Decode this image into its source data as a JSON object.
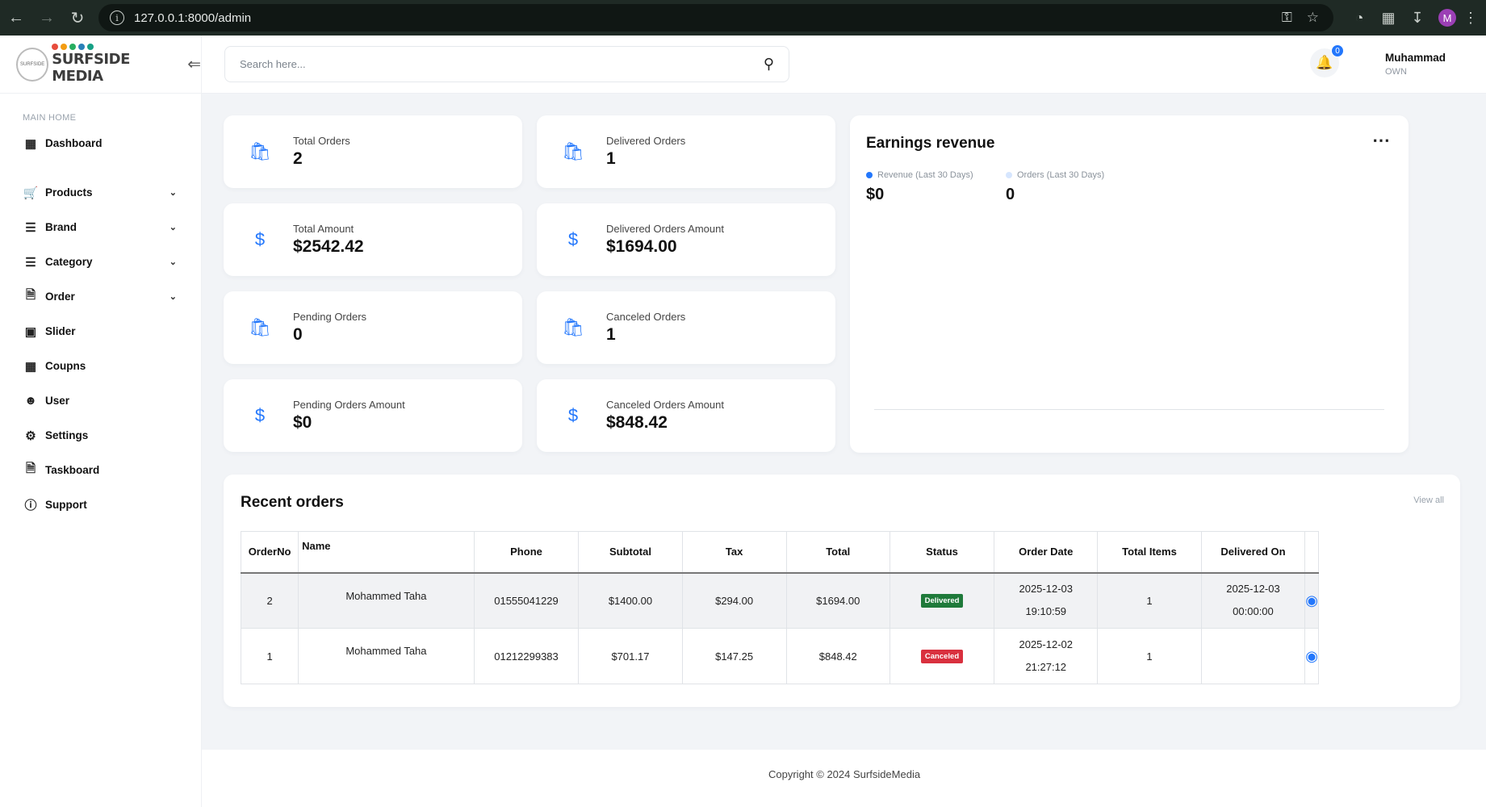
{
  "browser": {
    "url": "127.0.0.1:8000/admin",
    "profile_initial": "M"
  },
  "sidebar": {
    "logo_text": "SURFSIDE MEDIA",
    "section_label": "MAIN HOME",
    "items": [
      {
        "label": "Dashboard",
        "icon": "grid-icon"
      },
      {
        "label": "Products",
        "icon": "cart-icon"
      },
      {
        "label": "Brand",
        "icon": "layers-icon"
      },
      {
        "label": "Category",
        "icon": "layers-icon"
      },
      {
        "label": "Order",
        "icon": "file-plus-icon"
      },
      {
        "label": "Slider",
        "icon": "image-icon"
      },
      {
        "label": "Coupns",
        "icon": "grid-icon"
      },
      {
        "label": "User",
        "icon": "user-icon"
      },
      {
        "label": "Settings",
        "icon": "gear-icon"
      },
      {
        "label": "Taskboard",
        "icon": "file-icon"
      },
      {
        "label": "Support",
        "icon": "help-icon"
      }
    ]
  },
  "header": {
    "search_placeholder": "Search here...",
    "notification_count": "0",
    "user_name": "Muhammad",
    "user_role": "OWN"
  },
  "stats": [
    {
      "label": "Total Orders",
      "value": "2"
    },
    {
      "label": "Delivered Orders",
      "value": "1"
    },
    {
      "label": "Total Amount",
      "value": "$2542.42"
    },
    {
      "label": "Delivered Orders Amount",
      "value": "$1694.00"
    },
    {
      "label": "Pending Orders",
      "value": "0"
    },
    {
      "label": "Canceled Orders",
      "value": "1"
    },
    {
      "label": "Pending Orders Amount",
      "value": "$0"
    },
    {
      "label": "Canceled Orders Amount",
      "value": "$848.42"
    }
  ],
  "earnings": {
    "title": "Earnings revenue",
    "revenue_label": "Revenue (Last 30 Days)",
    "revenue_value": "$0",
    "orders_label": "Orders (Last 30 Days)",
    "orders_value": "0",
    "colors": {
      "revenue": "#2377fc",
      "orders": "#d6e6fe"
    }
  },
  "recent_orders": {
    "title": "Recent orders",
    "view_all": "View all",
    "columns": [
      "OrderNo",
      "Name",
      "Phone",
      "Subtotal",
      "Tax",
      "Total",
      "Status",
      "Order Date",
      "Total Items",
      "Delivered On",
      ""
    ],
    "rows": [
      {
        "order_no": "2",
        "name": "Mohammed Taha",
        "phone": "01555041229",
        "subtotal": "$1400.00",
        "tax": "$294.00",
        "total": "$1694.00",
        "status": "Delivered",
        "order_date": "2025-12-03",
        "order_time": "19:10:59",
        "total_items": "1",
        "delivered_date": "2025-12-03",
        "delivered_time": "00:00:00"
      },
      {
        "order_no": "1",
        "name": "Mohammed Taha",
        "phone": "01212299383",
        "subtotal": "$701.17",
        "tax": "$147.25",
        "total": "$848.42",
        "status": "Canceled",
        "order_date": "2025-12-02",
        "order_time": "21:27:12",
        "total_items": "1",
        "delivered_date": "",
        "delivered_time": ""
      }
    ]
  },
  "footer": {
    "copyright": "Copyright © 2024 SurfsideMedia"
  }
}
